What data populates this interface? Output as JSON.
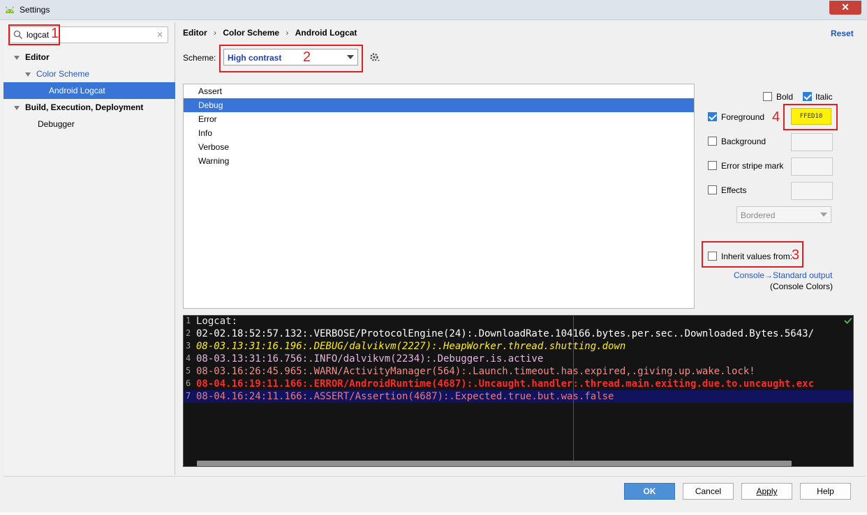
{
  "window": {
    "title": "Settings",
    "close_label": "✕"
  },
  "sidebar": {
    "search_value": "logcat",
    "search_placeholder": "",
    "search_clear": "⨯",
    "tree": [
      {
        "label": "Editor",
        "level": 0,
        "bold": true,
        "expanded": true
      },
      {
        "label": "Color Scheme",
        "level": 1,
        "bold": false,
        "expanded": true
      },
      {
        "label": "Android Logcat",
        "level": 2,
        "bold": false,
        "selected": true
      },
      {
        "label": "Build, Execution, Deployment",
        "level": 0,
        "bold": true,
        "expanded": true
      },
      {
        "label": "Debugger",
        "level": 1,
        "bold": false
      }
    ]
  },
  "breadcrumb": [
    "Editor",
    "Color Scheme",
    "Android Logcat"
  ],
  "breadcrumb_sep": "›",
  "reset_label": "Reset",
  "scheme": {
    "label": "Scheme:",
    "value": "High contrast"
  },
  "levels": {
    "items": [
      "Assert",
      "Debug",
      "Error",
      "Info",
      "Verbose",
      "Warning"
    ],
    "selected": "Debug"
  },
  "attributes": {
    "bold": {
      "label": "Bold",
      "checked": false
    },
    "italic": {
      "label": "Italic",
      "checked": true
    },
    "foreground": {
      "label": "Foreground",
      "checked": true,
      "value": "FFED10"
    },
    "background": {
      "label": "Background",
      "checked": false
    },
    "error_stripe": {
      "label": "Error stripe mark",
      "checked": false
    },
    "effects": {
      "label": "Effects",
      "checked": false,
      "effect_type": "Bordered"
    },
    "inherit": {
      "label": "Inherit values from:",
      "checked": false,
      "link": "Console→Standard output",
      "note": "(Console Colors)"
    }
  },
  "annotations": [
    "1",
    "2",
    "3",
    "4"
  ],
  "preview": {
    "lines": [
      {
        "num": "1",
        "text": "Logcat:"
      },
      {
        "num": "2",
        "text": "02-02.18:52:57.132:.VERBOSE/ProtocolEngine(24):.DownloadRate.104166.bytes.per.sec..Downloaded.Bytes.5643/"
      },
      {
        "num": "3",
        "text": "08-03.13:31:16.196:.DEBUG/dalvikvm(2227):.HeapWorker.thread.shutting.down"
      },
      {
        "num": "4",
        "text": "08-03.13:31:16.756:.INFO/dalvikvm(2234):.Debugger.is.active"
      },
      {
        "num": "5",
        "text": "08-03.16:26:45.965:.WARN/ActivityManager(564):.Launch.timeout.has.expired,.giving.up.wake.lock!"
      },
      {
        "num": "6",
        "text": "08-04.16:19:11.166:.ERROR/AndroidRuntime(4687):.Uncaught.handler:.thread.main.exiting.due.to.uncaught.exc"
      },
      {
        "num": "7",
        "text": "08-04.16:24:11.166:.ASSERT/Assertion(4687):.Expected.true.but.was.false"
      }
    ],
    "colors": {
      "header": "#e8e8e8",
      "verbose": "#ffffff",
      "debug": "#ffed10",
      "info": "#e6b8e0",
      "warn": "#f08d8d",
      "error": "#ff2a2a",
      "assert": "#e87a7a"
    }
  },
  "footer": {
    "ok": "OK",
    "cancel": "Cancel",
    "apply": "Apply",
    "help": "Help"
  }
}
